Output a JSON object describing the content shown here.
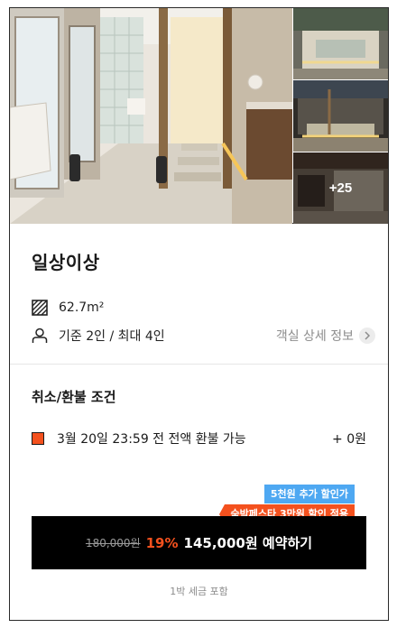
{
  "gallery": {
    "more_count_label": "+25"
  },
  "room": {
    "title": "일상이상",
    "area": "62.7m²",
    "capacity": "기준 2인 / 최대 4인",
    "detail_link_label": "객실 상세 정보"
  },
  "refund": {
    "section_title": "취소/환불 조건",
    "condition_text": "3월 20일 23:59 전 전액 환불 가능",
    "fee": "+ 0원"
  },
  "badges": {
    "extra_discount": "5천원 추가 할인가",
    "festa_discount": "숙박페스타 3만원 할인 적용"
  },
  "booking": {
    "original_price": "180,000원",
    "discount_rate": "19%",
    "cta_label": "145,000원 예약하기",
    "tax_note": "1박 세금 포함"
  },
  "colors": {
    "accent_orange": "#f4511e",
    "badge_blue": "#4ea8f2",
    "cta_black": "#000000",
    "muted_gray": "#8c8c8c"
  },
  "icons": [
    "area-icon",
    "person-icon",
    "chevron-right-icon",
    "refund-square-icon"
  ]
}
